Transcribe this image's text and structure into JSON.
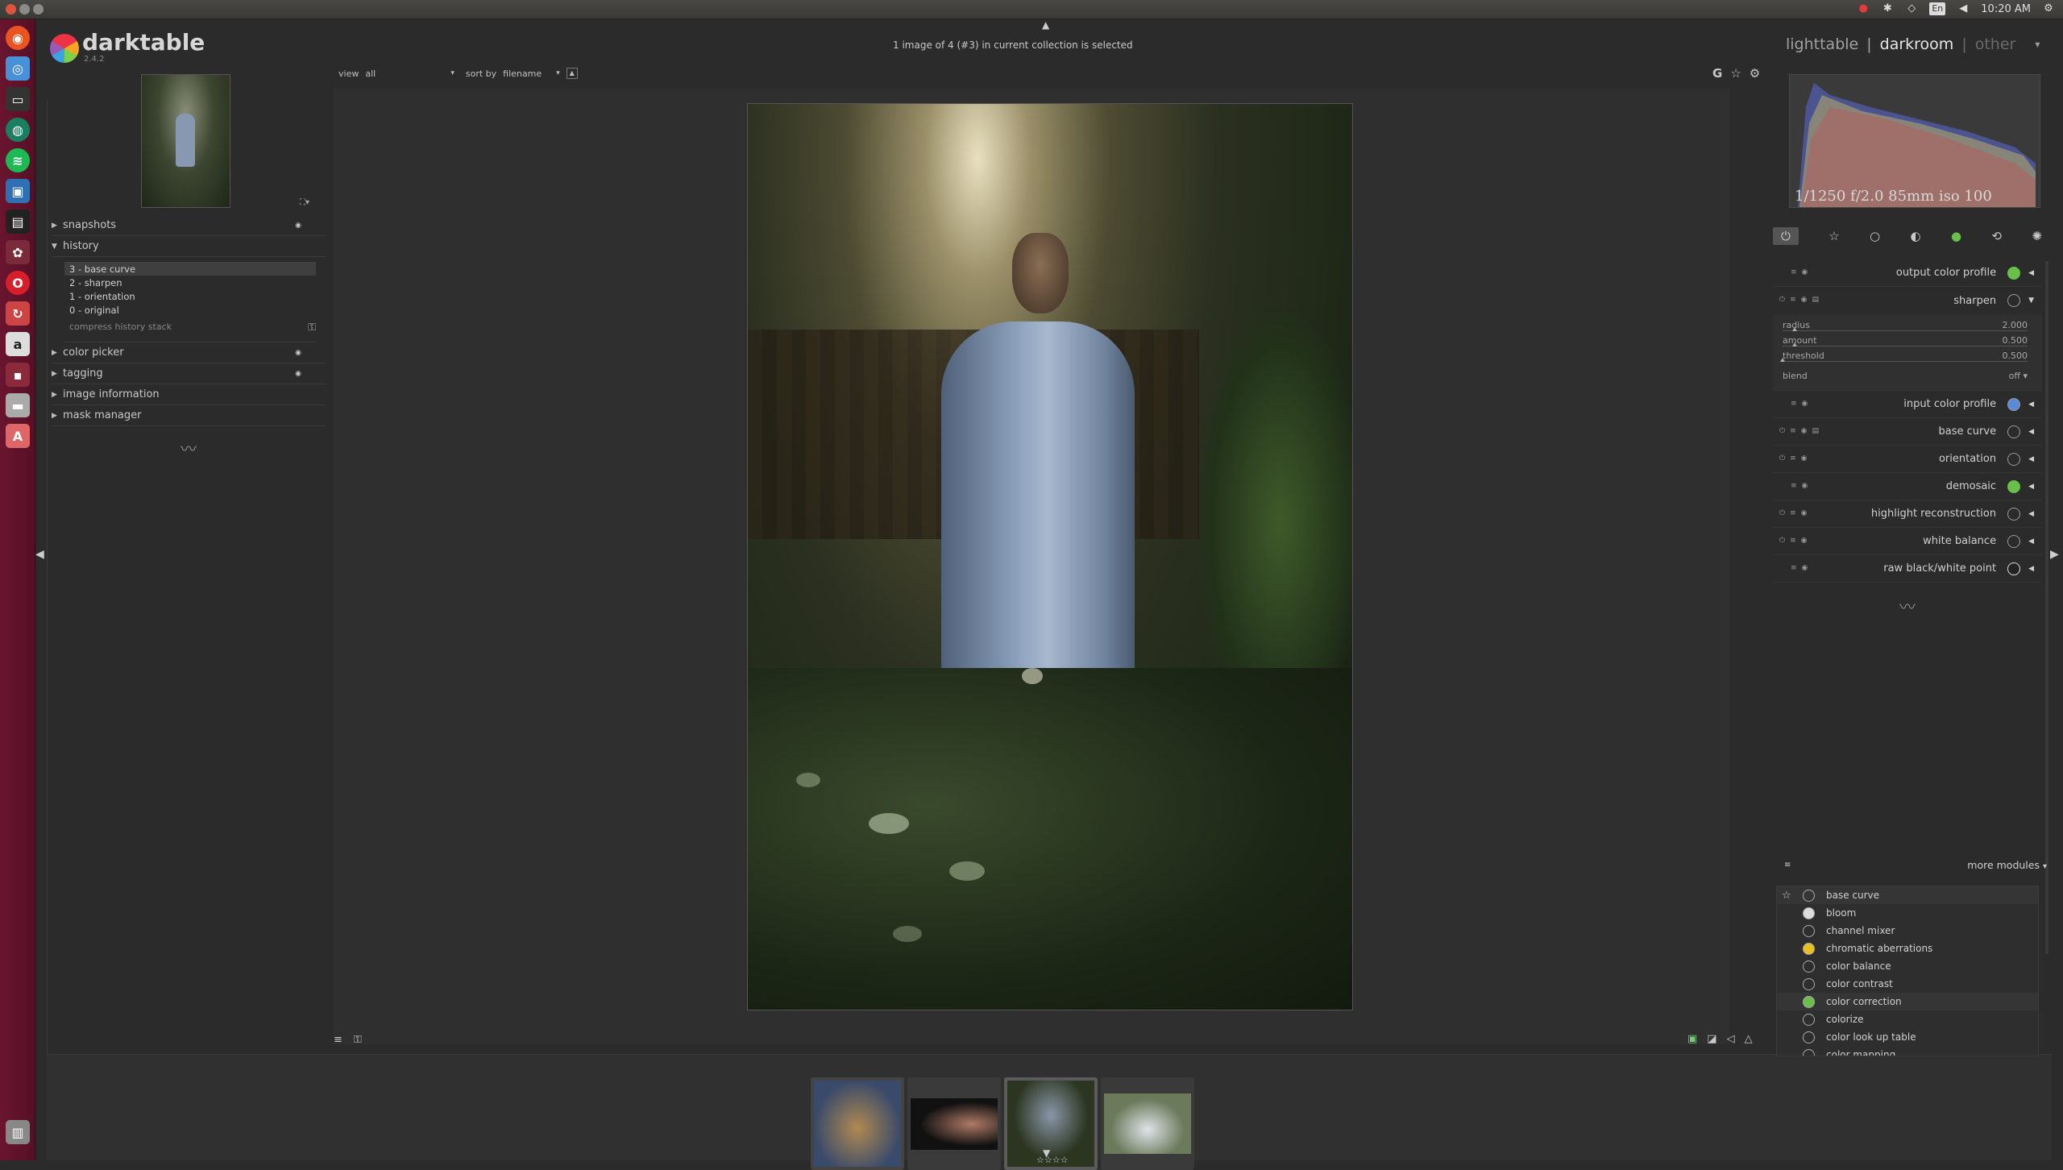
{
  "system": {
    "lang": "En",
    "time": "10:20 AM"
  },
  "header": {
    "app_name": "darktable",
    "version": "2.4.2",
    "collection_message": "1 image of 4 (#3) in current collection is selected",
    "views": {
      "lighttable": "lighttable",
      "separator": "|",
      "darkroom": "darkroom",
      "other": "other"
    }
  },
  "filter_bar": {
    "view_label": "view",
    "view_value": "all",
    "sort_label": "sort by",
    "sort_value": "filename"
  },
  "left_panel": {
    "snapshots": "snapshots",
    "history": "history",
    "history_items": [
      "3 - base curve",
      "2 - sharpen",
      "1 - orientation",
      "0 - original"
    ],
    "compress": "compress history stack",
    "color_picker": "color picker",
    "tagging": "tagging",
    "image_information": "image information",
    "mask_manager": "mask manager"
  },
  "histogram": {
    "exif": "1/1250 f/2.0 85mm iso 100"
  },
  "modules": {
    "output_color_profile": "output color profile",
    "sharpen": "sharpen",
    "sharpen_params": [
      {
        "label": "radius",
        "value": "2.000",
        "fraction": 0.05
      },
      {
        "label": "amount",
        "value": "0.500",
        "fraction": 0.05
      },
      {
        "label": "threshold",
        "value": "0.500",
        "fraction": 0.0
      }
    ],
    "blend_label": "blend",
    "blend_value": "off",
    "input_color_profile": "input color profile",
    "base_curve": "base curve",
    "orientation": "orientation",
    "demosaic": "demosaic",
    "highlight_reconstruction": "highlight reconstruction",
    "white_balance": "white balance",
    "raw_black_white_point": "raw black/white point"
  },
  "more_modules": {
    "title": "more modules",
    "items": [
      "base curve",
      "bloom",
      "channel mixer",
      "chromatic aberrations",
      "color balance",
      "color contrast",
      "color correction",
      "colorize",
      "color look up table",
      "color mapping"
    ]
  },
  "colors": {
    "panel_bg": "#2b2b2b",
    "launcher": "#6a1530",
    "accent_green": "#6abf4b"
  }
}
